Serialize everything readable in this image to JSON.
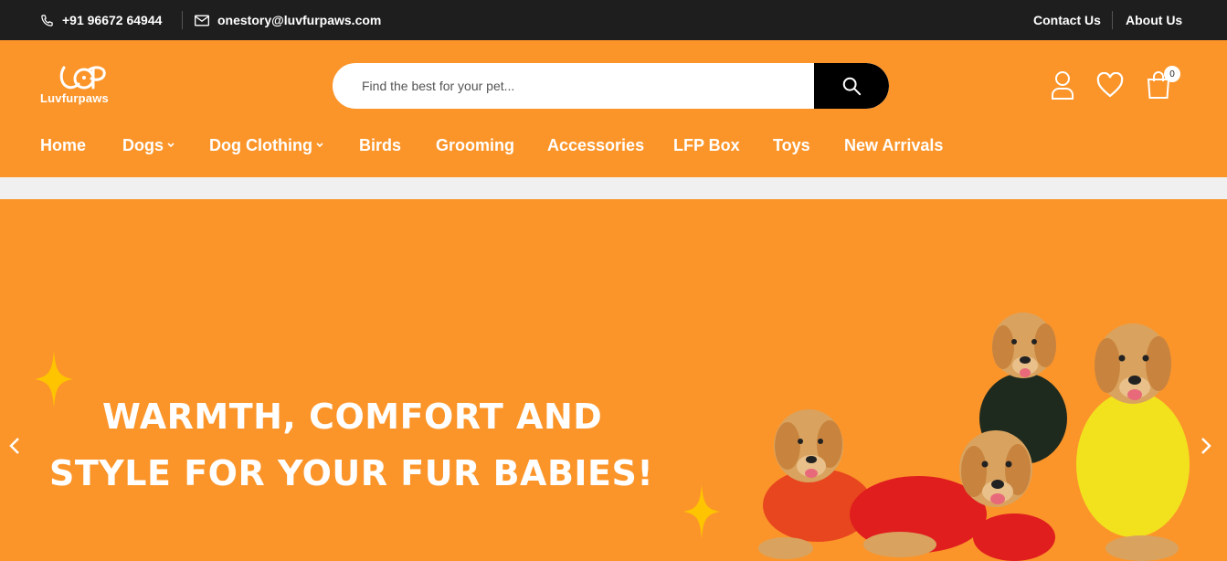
{
  "topbar": {
    "phone": "+91 96672 64944",
    "email": "onestory@luvfurpaws.com",
    "contact_label": "Contact Us",
    "about_label": "About Us"
  },
  "header": {
    "logo_text": "Luvfurpaws",
    "logo_mark": "LFP",
    "search_placeholder": "Find the best for your pet...",
    "cart_count": "0"
  },
  "nav": {
    "items": [
      {
        "label": "Home"
      },
      {
        "label": "Dogs"
      },
      {
        "label": "Dog Clothing"
      },
      {
        "label": "Birds"
      },
      {
        "label": "Grooming"
      },
      {
        "label": "Accessories"
      },
      {
        "label": "LFP Box"
      },
      {
        "label": "Toys"
      },
      {
        "label": "New Arrivals"
      }
    ]
  },
  "banner": {
    "line1": "WARMTH, COMFORT AND",
    "line2": "STYLE FOR YOUR FUR BABIES!",
    "image": "golden-retrievers-in-jackets"
  },
  "colors": {
    "brand_orange": "#fb952a",
    "topbar_bg": "#1e1e1e",
    "sparkle_yellow": "#ffc400",
    "search_button": "#000000"
  },
  "icons": [
    "phone-icon",
    "mail-icon",
    "search-icon",
    "user-icon",
    "heart-icon",
    "cart-icon",
    "chevron-down-icon",
    "chevron-left-icon",
    "chevron-right-icon",
    "sparkle-icon"
  ]
}
